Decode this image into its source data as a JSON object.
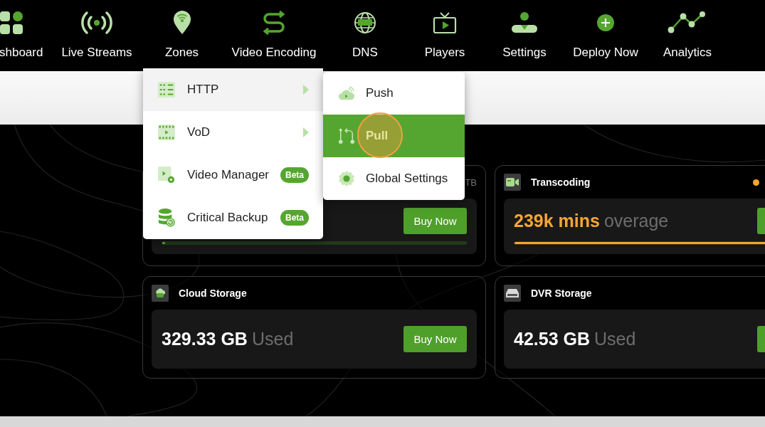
{
  "nav": [
    {
      "label": "shboard"
    },
    {
      "label": "Live Streams"
    },
    {
      "label": "Zones"
    },
    {
      "label": "Video Encoding"
    },
    {
      "label": "DNS"
    },
    {
      "label": "Players"
    },
    {
      "label": "Settings"
    },
    {
      "label": "Deploy Now"
    },
    {
      "label": "Analytics"
    }
  ],
  "menu": {
    "items": [
      {
        "label": "HTTP",
        "selected": true,
        "submenu": true
      },
      {
        "label": "VoD",
        "selected": false,
        "submenu": true
      },
      {
        "label": "Video Manager",
        "selected": false,
        "submenu": false,
        "badge": "Beta"
      },
      {
        "label": "Critical Backup",
        "selected": false,
        "submenu": false,
        "badge": "Beta"
      }
    ]
  },
  "submenu": {
    "items": [
      {
        "label": "Push",
        "selected": false
      },
      {
        "label": "Pull",
        "selected": true
      },
      {
        "label": "Global Settings",
        "selected": false
      }
    ]
  },
  "cards": [
    {
      "kind": "storage",
      "header_text": "TB",
      "button": "Buy Now",
      "progress": {
        "level": 0.01
      }
    },
    {
      "kind": "overage",
      "title": "Transcoding",
      "color": "#f5a623",
      "amount": "239k mins",
      "unit": "overage",
      "progress": {
        "level": 1
      }
    },
    {
      "kind": "storage",
      "title": "Cloud Storage",
      "amount": "329.33 GB",
      "unit": "Used",
      "button": "Buy Now"
    },
    {
      "kind": "storage",
      "title": "DVR Storage",
      "amount": "42.53 GB",
      "unit": "Used"
    }
  ]
}
